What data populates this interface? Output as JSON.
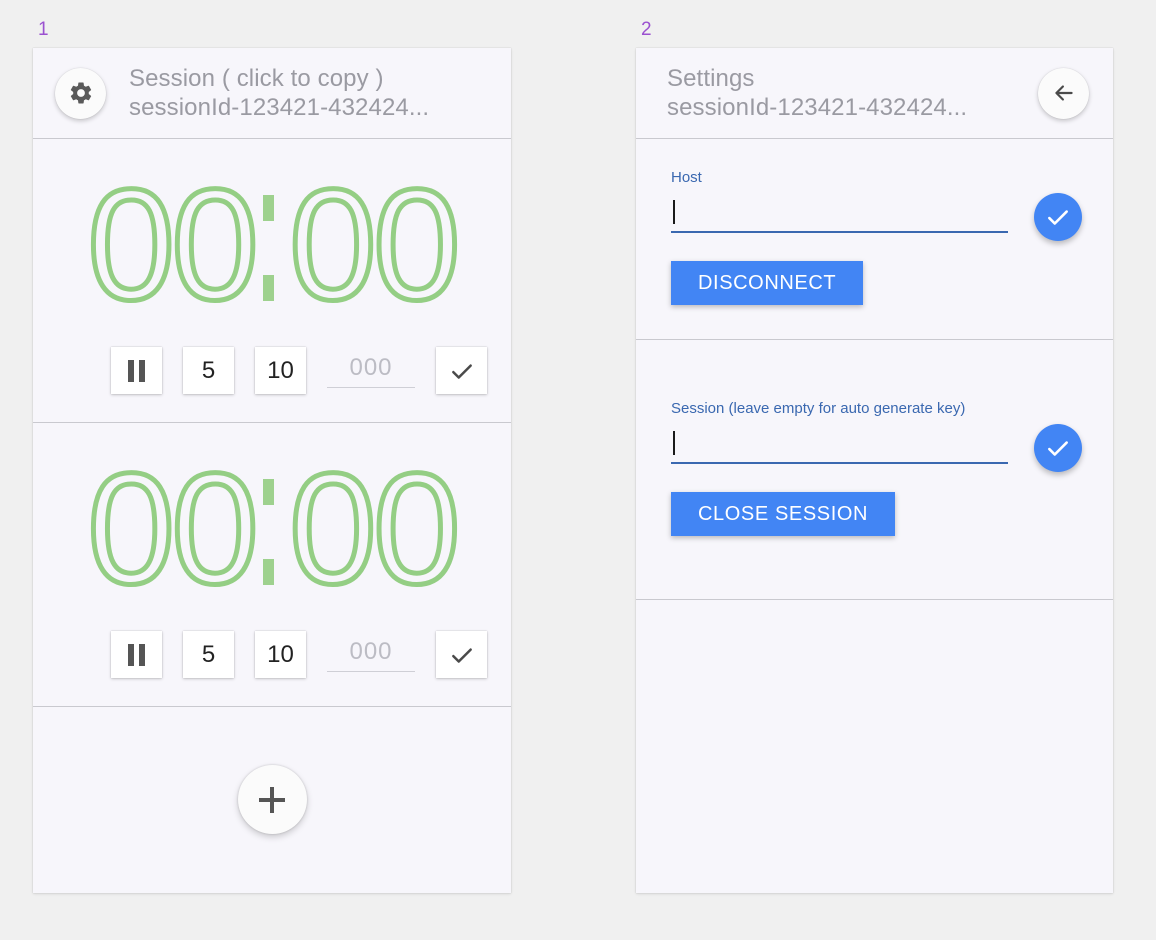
{
  "panels": {
    "one_label": "1",
    "two_label": "2"
  },
  "timer_panel": {
    "header": {
      "title": "Session ( click to copy )",
      "session_id": "sessionId-123421-432424...",
      "settings_icon": "gear-icon"
    },
    "timers": [
      {
        "display": {
          "d1": "0",
          "d2": "0",
          "d3": "0",
          "d4": "0"
        },
        "controls": {
          "pause_label": "pause-icon",
          "preset_1": "5",
          "preset_2": "10",
          "custom_placeholder": "000",
          "custom_value": "",
          "confirm_label": "check-icon"
        }
      },
      {
        "display": {
          "d1": "0",
          "d2": "0",
          "d3": "0",
          "d4": "0"
        },
        "controls": {
          "pause_label": "pause-icon",
          "preset_1": "5",
          "preset_2": "10",
          "custom_placeholder": "000",
          "custom_value": "",
          "confirm_label": "check-icon"
        }
      }
    ],
    "add_button": {
      "icon": "plus-icon"
    }
  },
  "settings_panel": {
    "header": {
      "title": "Settings",
      "session_id": "sessionId-123421-432424...",
      "back_icon": "arrow-left-icon"
    },
    "host_section": {
      "label": "Host",
      "value": "",
      "confirm_icon": "check-icon",
      "button_label": "DISCONNECT"
    },
    "session_section": {
      "label": "Session (leave empty for auto generate key)",
      "value": "",
      "confirm_icon": "check-icon",
      "button_label": "CLOSE SESSION"
    }
  },
  "colors": {
    "page_background": "#f0f0f0",
    "panel_background": "#f7f6fb",
    "timer_green": "#94ce84",
    "accent_blue": "#4285f4",
    "label_blue": "#3a68b0",
    "panel_number_purple": "#9b51d0",
    "muted_text": "#9a9aa2"
  }
}
